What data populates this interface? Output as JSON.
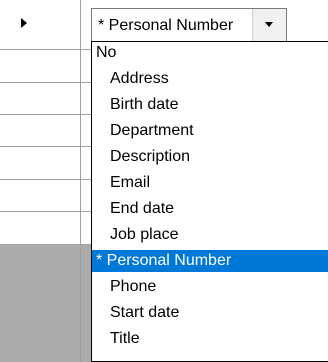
{
  "combo": {
    "value": "* Personal Number",
    "dropdown_icon": "chevron-down-icon"
  },
  "row_header": {
    "current_row_icon": "triangle-right-icon"
  },
  "dropdown": {
    "items": [
      {
        "label": "No"
      },
      {
        "label": "Address"
      },
      {
        "label": "Birth date"
      },
      {
        "label": "Department"
      },
      {
        "label": "Description"
      },
      {
        "label": "Email"
      },
      {
        "label": "End date"
      },
      {
        "label": "Job place"
      },
      {
        "label": "* Personal Number",
        "selected": true
      },
      {
        "label": "Phone"
      },
      {
        "label": "Start date"
      },
      {
        "label": "Title"
      }
    ]
  },
  "colors": {
    "selection": "#0078d7",
    "grid_line": "#a0a0a0",
    "empty_area": "#ababab"
  }
}
